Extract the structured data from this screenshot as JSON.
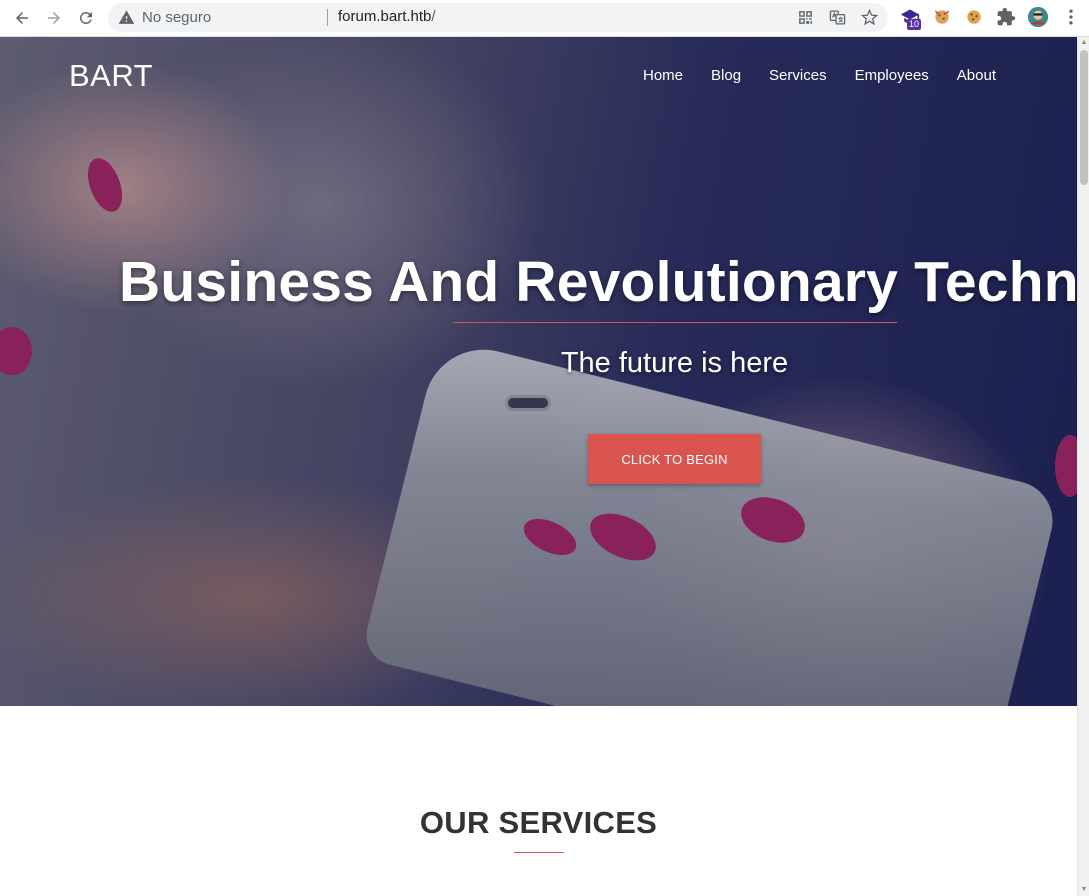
{
  "browser": {
    "security_label": "No seguro",
    "url_host": "forum.bart.htb",
    "url_path": "/",
    "extension_badge": "10"
  },
  "site": {
    "brand": "BART",
    "nav": [
      "Home",
      "Blog",
      "Services",
      "Employees",
      "About"
    ]
  },
  "hero": {
    "title": "Business And Revolutionary Techno",
    "subtitle": "The future is here",
    "cta_label": "CLICK TO BEGIN"
  },
  "services": {
    "title": "OUR SERVICES"
  },
  "colors": {
    "accent": "#d9534f",
    "hero_dark": "#1c2150",
    "text_dark": "#333333"
  }
}
